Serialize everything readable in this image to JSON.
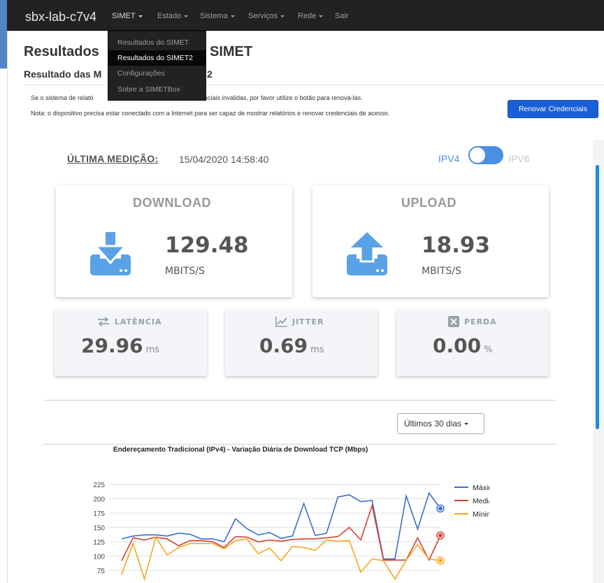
{
  "navbar": {
    "brand": "sbx-lab-c7v4",
    "items": [
      {
        "label": "SIMET",
        "has_caret": true
      },
      {
        "label": "Estado",
        "has_caret": true
      },
      {
        "label": "Sistema",
        "has_caret": true
      },
      {
        "label": "Serviços",
        "has_caret": true
      },
      {
        "label": "Rede",
        "has_caret": true
      },
      {
        "label": "Sair",
        "has_caret": false
      }
    ]
  },
  "dropdown": {
    "items": [
      {
        "label": "Resultados do SIMET",
        "selected": false
      },
      {
        "label": "Resultados do SIMET2",
        "selected": true
      },
      {
        "label": "Configurações",
        "selected": false
      },
      {
        "label": "Sobre a SIMETBox",
        "selected": false
      }
    ]
  },
  "page": {
    "title_left": "Resultados",
    "title_right": "SIMET",
    "subtitle_left": "Resultado das M",
    "subtitle_right": "2",
    "notice1_left": "Se o sistema de relató",
    "notice1_right": "enciais inválidas, por favor utilize o botão para renová-las.",
    "notice2": "Nota: o dispositivo precisa estar conectado com a Internet para ser capaz de mostrar relatórios e renovar credenciais de acesso.",
    "renew_button": "Renovar Credenciais"
  },
  "measurement": {
    "last_label": "ÚLTIMA MEDIÇÃO",
    "last_colon": ":",
    "last_value": "15/04/2020 14:58:40",
    "ipv4": "IPV4",
    "ipv6": "IPV6",
    "download": {
      "title": "DOWNLOAD",
      "value": "129.48",
      "unit": "MBITS/S"
    },
    "upload": {
      "title": "UPLOAD",
      "value": "18.93",
      "unit": "MBITS/S"
    },
    "latency": {
      "title": "LATÊNCIA",
      "value": "29.96",
      "unit": "ms"
    },
    "jitter": {
      "title": "JITTER",
      "value": "0.69",
      "unit": "ms"
    },
    "loss": {
      "title": "PERDA",
      "value": "0.00",
      "unit": "%"
    },
    "period": "Últimos 30 dias"
  },
  "colors": {
    "accent": "#1a5fd6",
    "icon_blue": "#5aa2e6",
    "max_series": "#3c6fc8",
    "median_series": "#d9412e",
    "min_series": "#f5a623"
  },
  "chart_data": {
    "type": "line",
    "title": "Endereçamento Tradicional (IPv4) - Variação Diária de Download TCP (Mbps)",
    "ylim": [
      75,
      225
    ],
    "yticks": [
      225,
      200,
      175,
      150,
      125,
      100,
      75
    ],
    "series": [
      {
        "name": "Máxima",
        "values": [
          130,
          135,
          137,
          137,
          135,
          140,
          138,
          130,
          130,
          125,
          165,
          148,
          137,
          141,
          131,
          135,
          192,
          136,
          140,
          203,
          207,
          195,
          197,
          95,
          95,
          205,
          147,
          210,
          183
        ]
      },
      {
        "name": "Mediana",
        "values": [
          92,
          132,
          128,
          133,
          130,
          118,
          127,
          127,
          125,
          115,
          134,
          133,
          125,
          128,
          126,
          129,
          130,
          130,
          132,
          134,
          150,
          128,
          188,
          93,
          93,
          93,
          132,
          93,
          136
        ]
      },
      {
        "name": "Mínima",
        "values": [
          68,
          122,
          60,
          133,
          102,
          115,
          122,
          122,
          122,
          113,
          127,
          130,
          104,
          114,
          92,
          117,
          115,
          110,
          128,
          126,
          127,
          72,
          95,
          92,
          60,
          93,
          120,
          95,
          92
        ]
      }
    ]
  }
}
